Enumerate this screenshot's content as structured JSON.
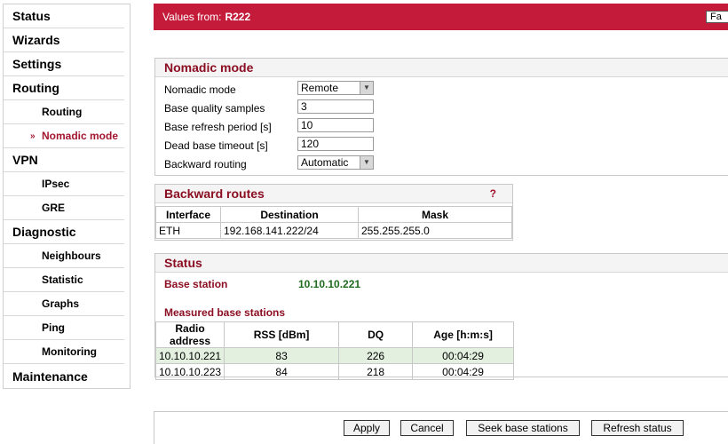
{
  "sidebar": {
    "items": [
      {
        "label": "Status",
        "level": "top"
      },
      {
        "label": "Wizards",
        "level": "top"
      },
      {
        "label": "Settings",
        "level": "top"
      },
      {
        "label": "Routing",
        "level": "top"
      },
      {
        "label": "Routing",
        "level": "sub"
      },
      {
        "label": "Nomadic mode",
        "level": "sub",
        "active": true
      },
      {
        "label": "VPN",
        "level": "top"
      },
      {
        "label": "IPsec",
        "level": "sub"
      },
      {
        "label": "GRE",
        "level": "sub"
      },
      {
        "label": "Diagnostic",
        "level": "top"
      },
      {
        "label": "Neighbours",
        "level": "sub"
      },
      {
        "label": "Statistic",
        "level": "sub"
      },
      {
        "label": "Graphs",
        "level": "sub"
      },
      {
        "label": "Ping",
        "level": "sub"
      },
      {
        "label": "Monitoring",
        "level": "sub"
      },
      {
        "label": "Maintenance",
        "level": "top"
      }
    ],
    "active_marker": "»"
  },
  "header": {
    "prefix": "Values from:",
    "station": "R222",
    "button": "Fa"
  },
  "nomadic": {
    "title": "Nomadic mode",
    "fields": [
      {
        "label": "Nomadic mode",
        "value": "Remote",
        "type": "select"
      },
      {
        "label": "Base quality samples",
        "value": "3",
        "type": "input"
      },
      {
        "label": "Base refresh period [s]",
        "value": "10",
        "type": "input"
      },
      {
        "label": "Dead base timeout [s]",
        "value": "120",
        "type": "input"
      },
      {
        "label": "Backward routing",
        "value": "Automatic",
        "type": "select"
      }
    ]
  },
  "routes": {
    "title": "Backward routes",
    "help": "?",
    "columns": [
      "Interface",
      "Destination",
      "Mask"
    ],
    "rows": [
      [
        "ETH",
        "192.168.141.222/24",
        "255.255.255.0"
      ]
    ]
  },
  "status": {
    "title": "Status",
    "base_label": "Base station",
    "base_value": "10.10.10.221",
    "measured_title": "Measured base stations",
    "columns": [
      "Radio address",
      "RSS [dBm]",
      "DQ",
      "Age [h:m:s]"
    ],
    "rows": [
      [
        "10.10.10.221",
        "83",
        "226",
        "00:04:29"
      ],
      [
        "10.10.10.223",
        "84",
        "218",
        "00:04:29"
      ]
    ]
  },
  "footer": {
    "apply": "Apply",
    "cancel": "Cancel",
    "seek": "Seek base stations",
    "refresh": "Refresh status"
  },
  "colors": {
    "accent": "#c41b3a",
    "dark_red": "#8b0e23",
    "green": "#1f6b1f"
  }
}
